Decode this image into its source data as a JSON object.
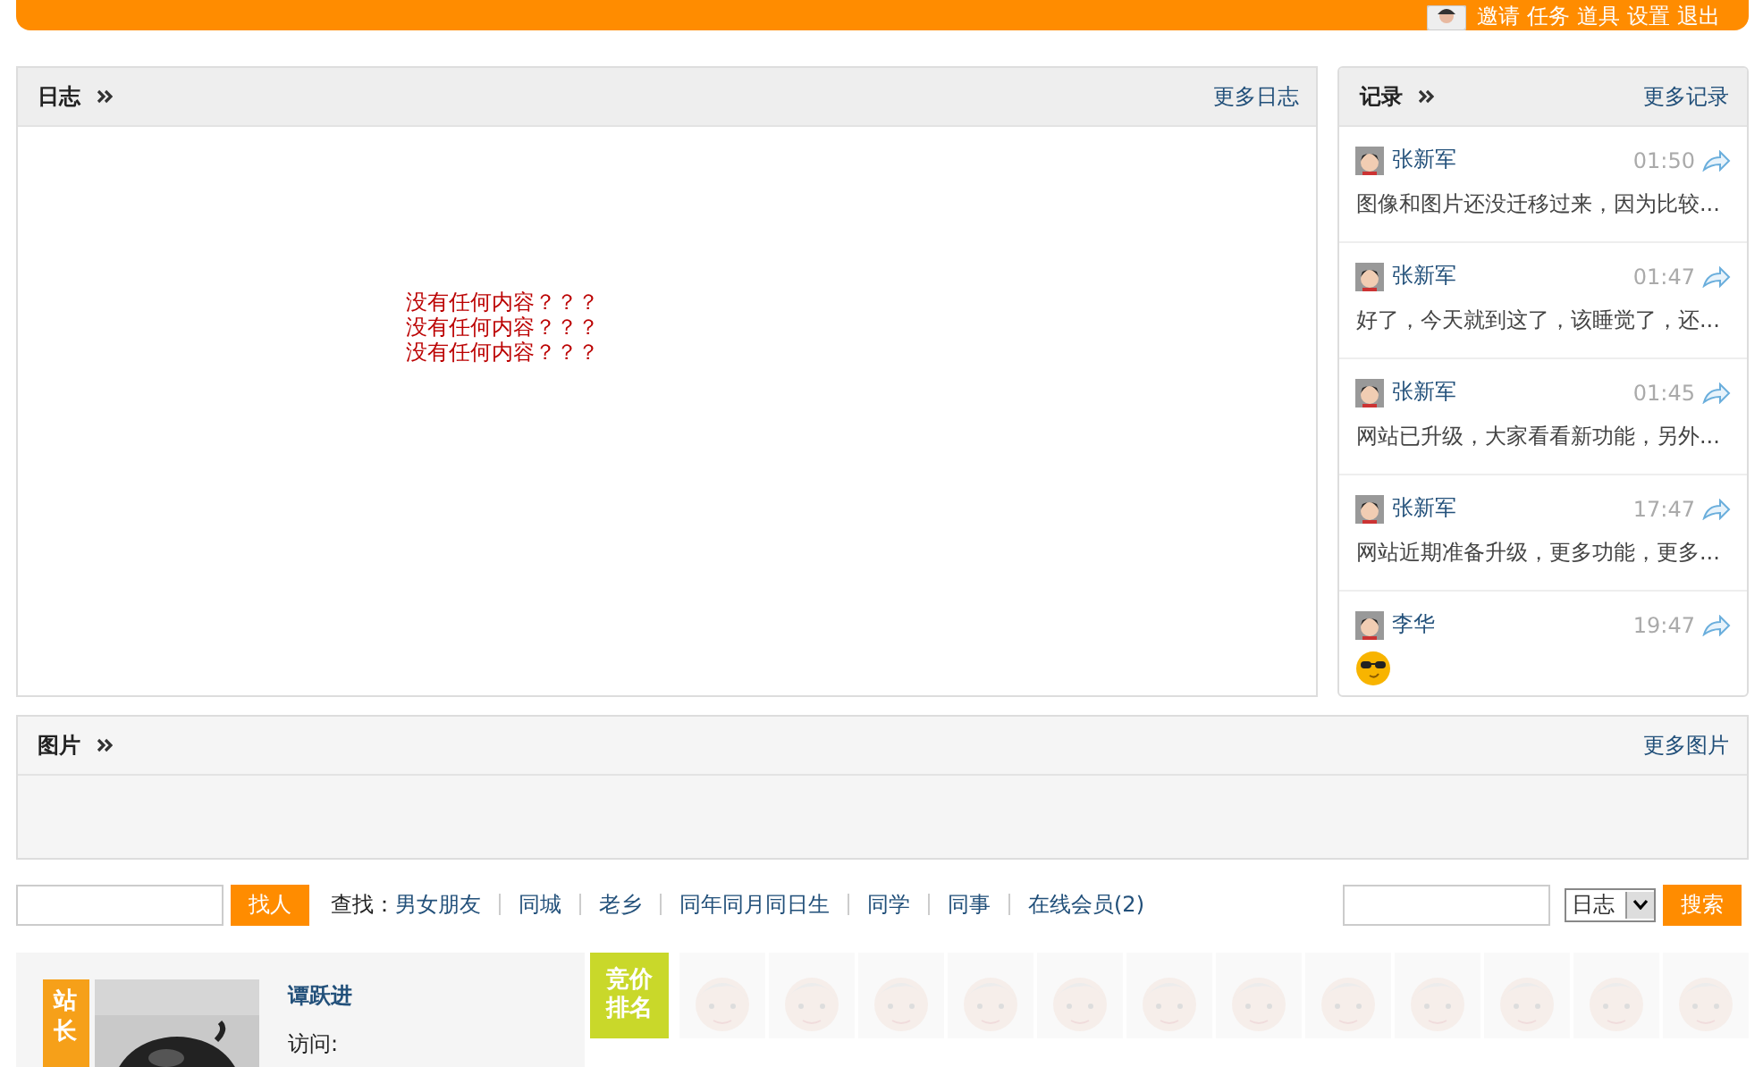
{
  "top_nav": {
    "user_links": [
      "邀请",
      "任务",
      "道具",
      "设置",
      "退出"
    ]
  },
  "journal": {
    "title": "日志",
    "more": "更多日志",
    "empty_lines": [
      "没有任何内容？？？",
      "没有任何内容？？？",
      "没有任何内容？？？"
    ]
  },
  "records": {
    "title": "记录",
    "more": "更多记录",
    "items": [
      {
        "name": "张新军",
        "time": "01:50",
        "kind": "text",
        "text": "图像和图片还没迁移过来，因为比较..."
      },
      {
        "name": "张新军",
        "time": "01:47",
        "kind": "text",
        "text": "好了，今天就到这了，该睡觉了，还..."
      },
      {
        "name": "张新军",
        "time": "01:45",
        "kind": "text",
        "text": "网站已升级，大家看看新功能，另外..."
      },
      {
        "name": "张新军",
        "time": "17:47",
        "kind": "text",
        "text": "网站近期准备升级，更多功能，更多..."
      },
      {
        "name": "李华",
        "time": "19:47",
        "kind": "emoji"
      }
    ]
  },
  "pictures": {
    "title": "图片",
    "more": "更多图片"
  },
  "search_bar": {
    "find_button": "找人",
    "find_label": "查找：",
    "links": [
      "男女朋友",
      "同城",
      "老乡",
      "同年同月同日生",
      "同学",
      "同事",
      "在线会员(2)"
    ],
    "select_value": "日志",
    "search_button": "搜索"
  },
  "featured": {
    "tag": "站长",
    "name": "谭跃进",
    "visits_label": "访问:"
  },
  "bidding": {
    "tag": "竞价排名"
  }
}
